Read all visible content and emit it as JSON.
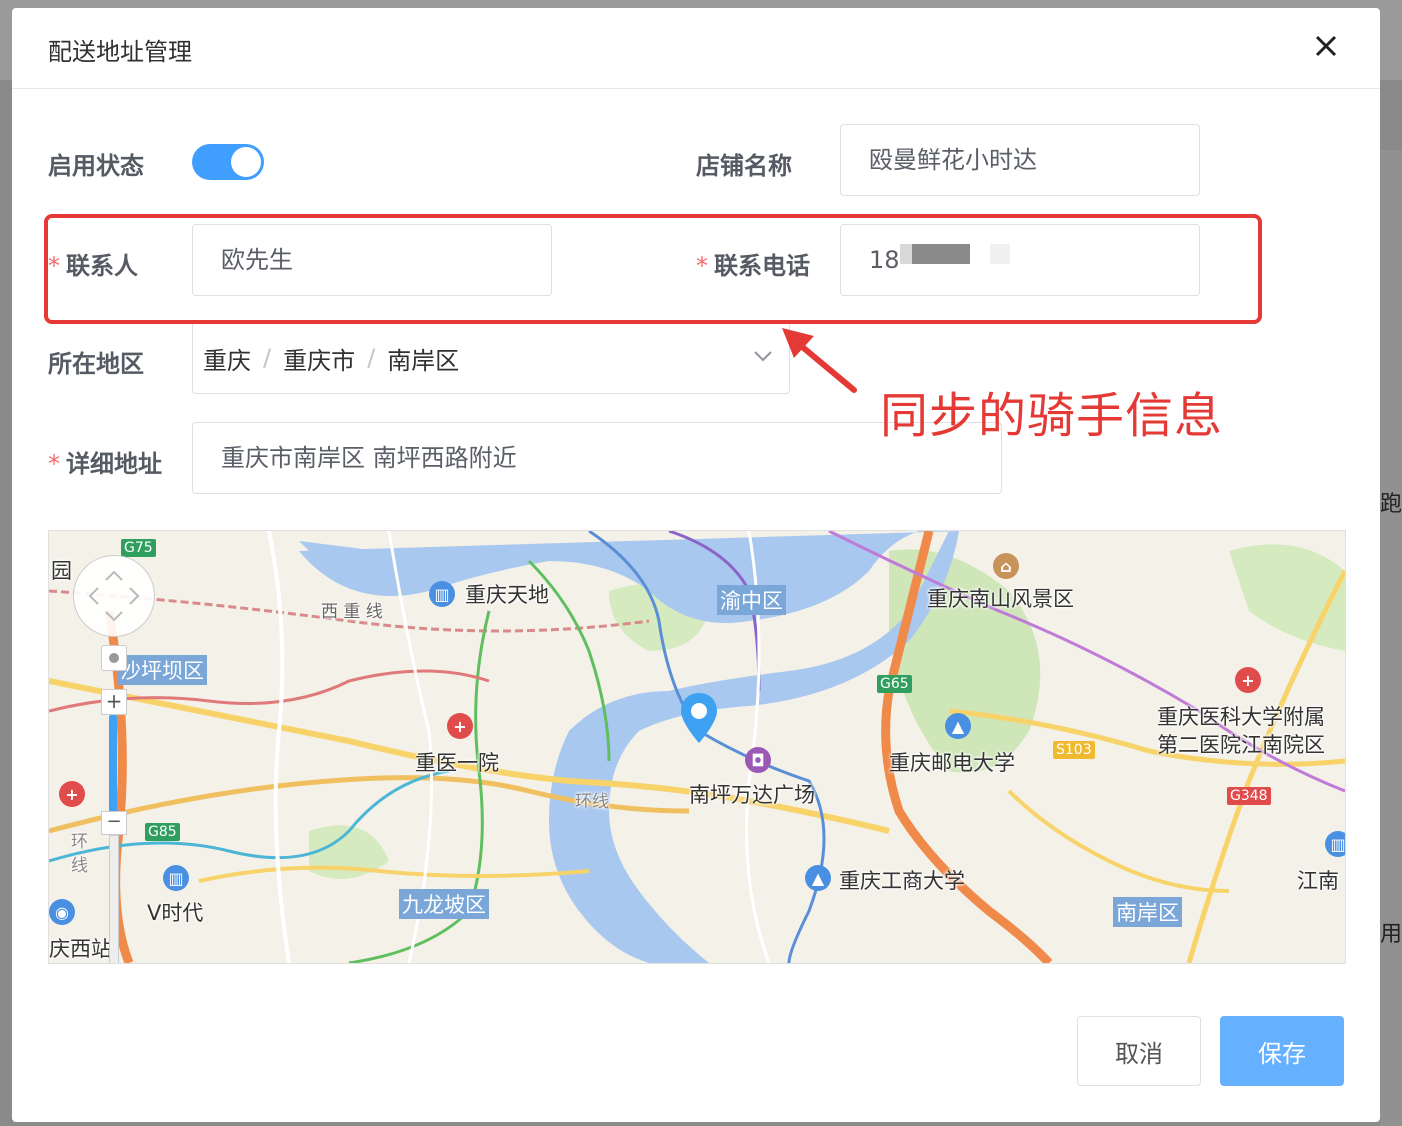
{
  "dialog": {
    "title": "配送地址管理",
    "close_icon": "close-icon"
  },
  "form": {
    "status_label": "启用状态",
    "status_enabled": true,
    "shop_label": "店铺名称",
    "shop_value": "殴曼鲜花小时达",
    "contact_label": "联系人",
    "contact_value": "欧先生",
    "phone_label": "联系电话",
    "phone_value": "18",
    "region_label": "所在地区",
    "region_path": [
      "重庆",
      "重庆市",
      "南岸区"
    ],
    "address_label": "详细地址",
    "address_value": "重庆市南岸区 南坪西路附近",
    "required_mark": "*"
  },
  "annotation": {
    "text": "同步的骑手信息",
    "color": "#e53935"
  },
  "map": {
    "labels": {
      "tiandi": "重庆天地",
      "xichongxian": "西 重 线",
      "yuzhong": "渝中区",
      "nanshan": "重庆南山风景区",
      "shapingba": "沙坪坝区",
      "chongyi": "重医一院",
      "huanxian": "环线",
      "wanda": "南坪万达广场",
      "youdian": "重庆邮电大学",
      "yike_1": "重庆医科大学附属",
      "yike_2": "第二医院江南院区",
      "gongshang": "重庆工商大学",
      "jiulongpo": "九龙坡区",
      "nanan": "南岸区",
      "jiangnan": "江南",
      "vshidai": "V时代",
      "xizhan": "庆西站",
      "yuan": "园",
      "huan2": "环",
      "xian2": "线"
    },
    "highways": [
      "G75",
      "G65",
      "S103",
      "G348",
      "G85"
    ],
    "zoom_in": "+",
    "zoom_out": "−"
  },
  "buttons": {
    "cancel": "取消",
    "save": "保存"
  },
  "colors": {
    "primary": "#409eff",
    "save_bg": "#66b1ff",
    "required": "#f56c6c",
    "annotation": "#e53935"
  },
  "background_page": {
    "fragment_1": "跑",
    "fragment_2": "用"
  }
}
